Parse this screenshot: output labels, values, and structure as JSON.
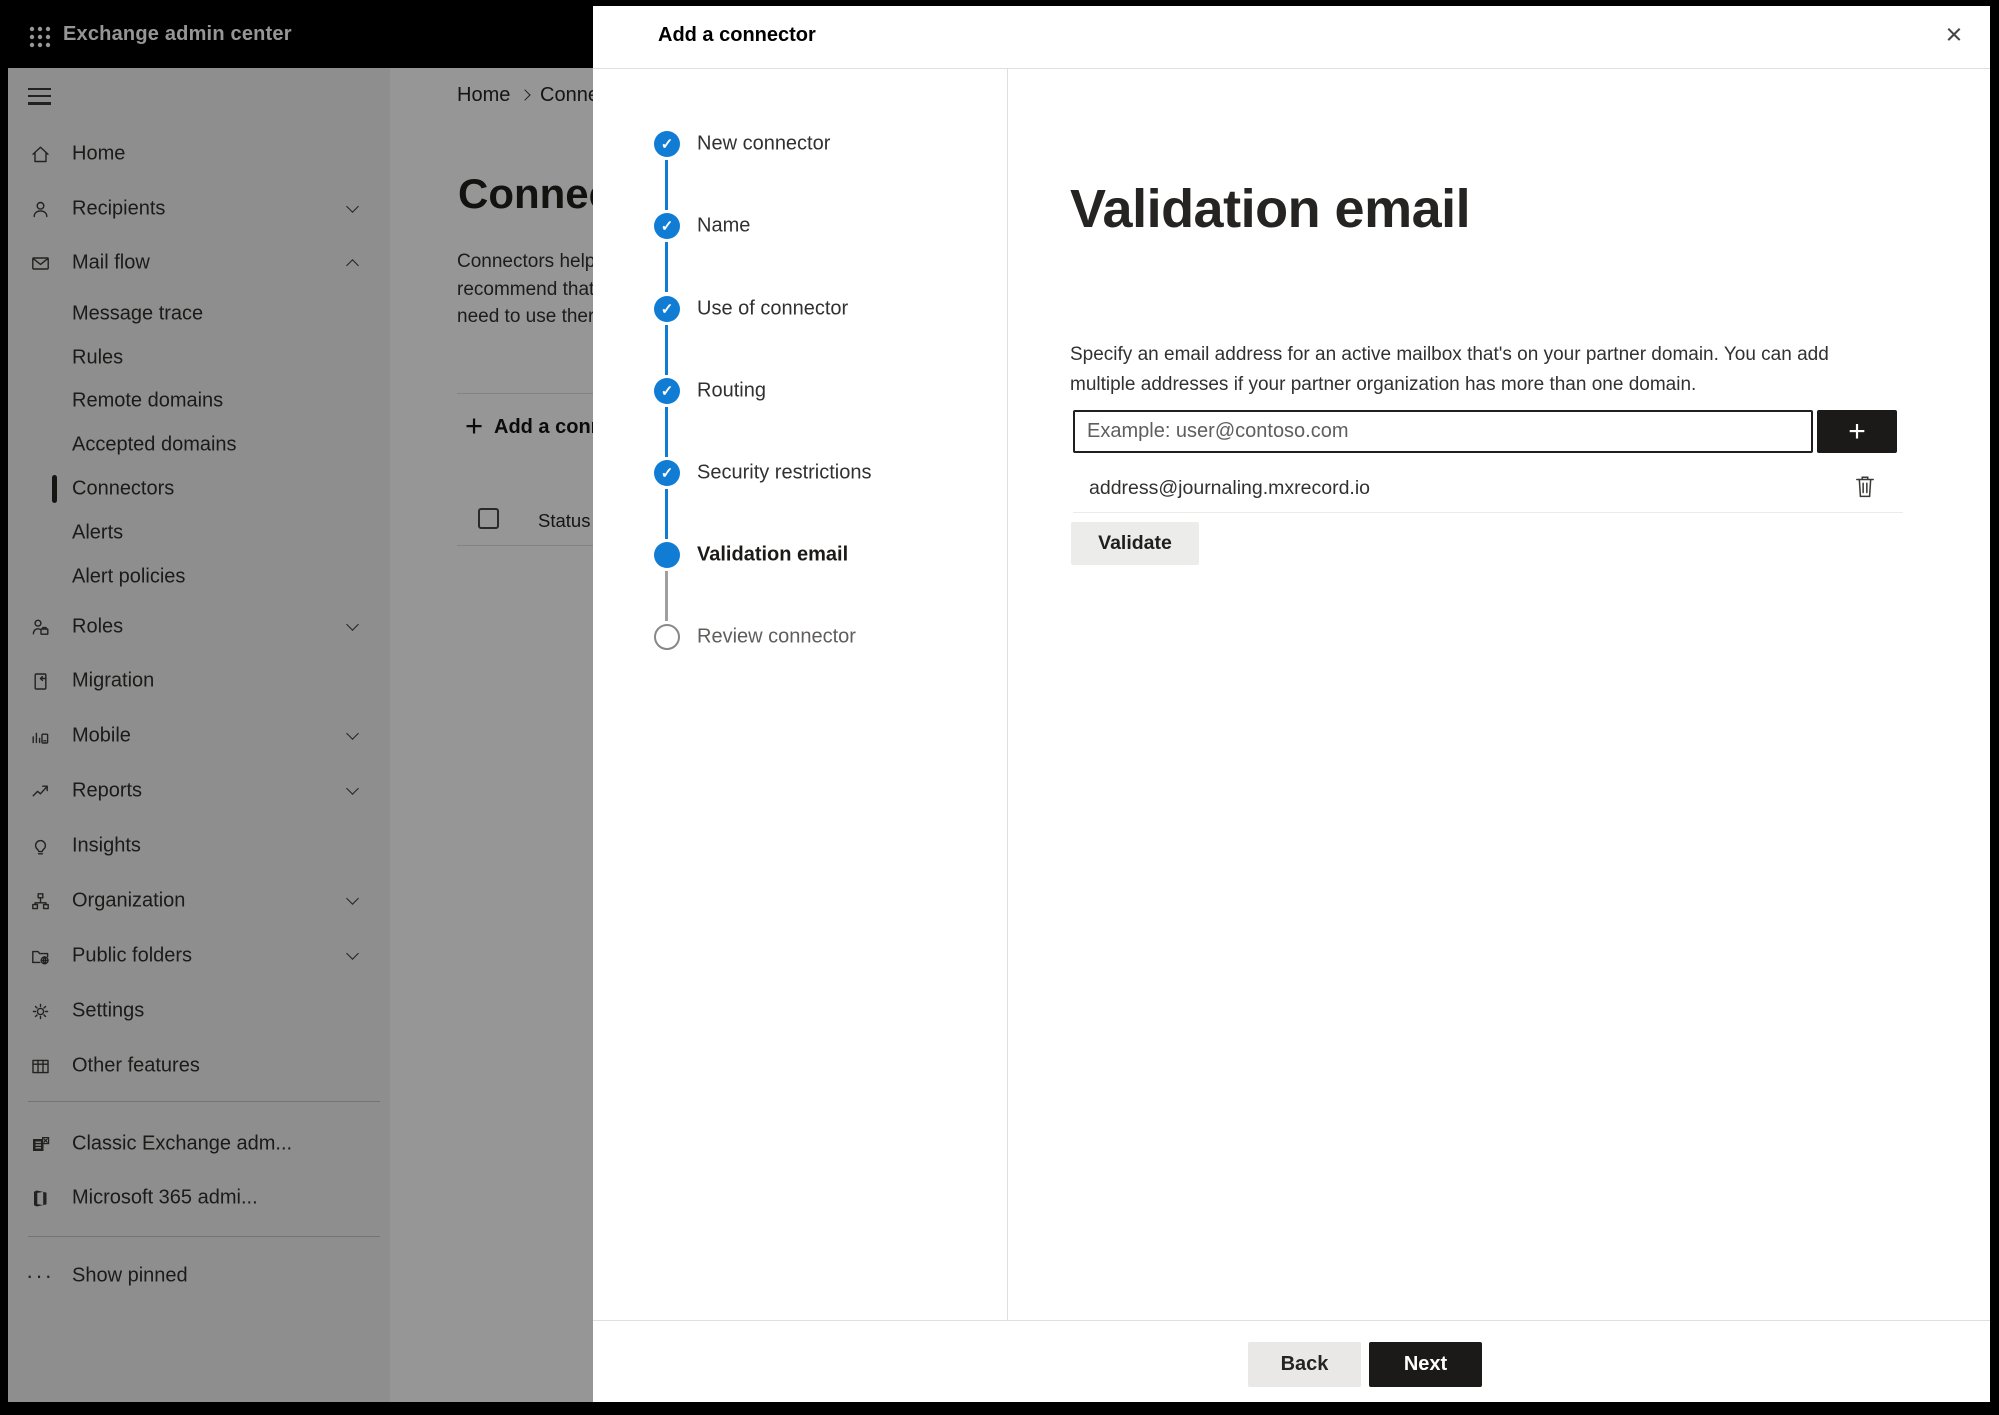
{
  "topbar": {
    "title": "Exchange admin center"
  },
  "sidebar": {
    "items": [
      {
        "label": "Home"
      },
      {
        "label": "Recipients"
      },
      {
        "label": "Mail flow"
      },
      {
        "label": "Message trace"
      },
      {
        "label": "Rules"
      },
      {
        "label": "Remote domains"
      },
      {
        "label": "Accepted domains"
      },
      {
        "label": "Connectors",
        "selected": true
      },
      {
        "label": "Alerts"
      },
      {
        "label": "Alert policies"
      },
      {
        "label": "Roles"
      },
      {
        "label": "Migration"
      },
      {
        "label": "Mobile"
      },
      {
        "label": "Reports"
      },
      {
        "label": "Insights"
      },
      {
        "label": "Organization"
      },
      {
        "label": "Public folders"
      },
      {
        "label": "Settings"
      },
      {
        "label": "Other features"
      },
      {
        "label": "Classic Exchange adm..."
      },
      {
        "label": "Microsoft 365 admi..."
      },
      {
        "label": "Show pinned"
      }
    ]
  },
  "page": {
    "breadcrumb": {
      "home": "Home",
      "current": "Connec"
    },
    "heading": "Connect",
    "intro_lines": [
      "Connectors help",
      "recommend that",
      "need to use ther"
    ],
    "add_connector_label": "Add a conn",
    "status_header": "Status"
  },
  "dialog": {
    "title": "Add a connector",
    "steps": [
      {
        "label": "New connector",
        "state": "done"
      },
      {
        "label": "Name",
        "state": "done"
      },
      {
        "label": "Use of connector",
        "state": "done"
      },
      {
        "label": "Routing",
        "state": "done"
      },
      {
        "label": "Security restrictions",
        "state": "done"
      },
      {
        "label": "Validation email",
        "state": "current"
      },
      {
        "label": "Review connector",
        "state": "upcoming"
      }
    ],
    "content": {
      "heading": "Validation email",
      "description": "Specify an email address for an active mailbox that's on your partner domain. You can add multiple addresses if your partner organization has more than one domain.",
      "email_placeholder": "Example: user@contoso.com",
      "address": "address@journaling.mxrecord.io",
      "validate_label": "Validate"
    },
    "footer": {
      "back_label": "Back",
      "next_label": "Next"
    }
  },
  "glyphs": {
    "check": "✓",
    "close": "×",
    "plus": "+",
    "dots": "···"
  },
  "colors": {
    "accent_blue": "#107cd4",
    "topbar_bg": "#000000",
    "sidebar_bg": "#f3f2f1",
    "dark_button": "#1b1a19",
    "pending_gray": "#8a8886"
  }
}
